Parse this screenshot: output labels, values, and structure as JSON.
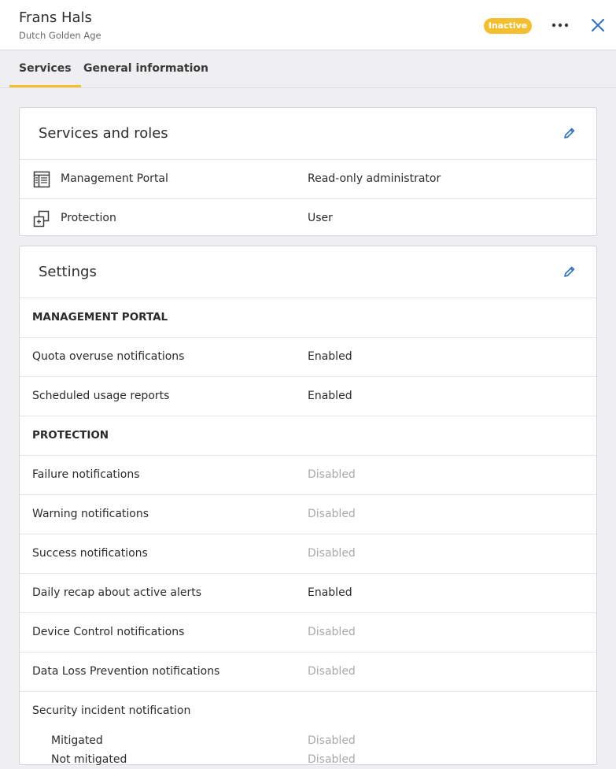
{
  "header": {
    "title": "Frans Hals",
    "subtitle": "Dutch Golden Age",
    "status_badge": "Inactive",
    "more_icon": "more-horizontal-icon",
    "close_icon": "close-icon"
  },
  "tabs": [
    {
      "label": "Services",
      "active": true
    },
    {
      "label": "General information",
      "active": false
    }
  ],
  "services_card": {
    "title": "Services and roles",
    "edit_icon": "pencil-icon",
    "rows": [
      {
        "icon": "management-portal-icon",
        "label": "Management Portal",
        "value": "Read-only administrator"
      },
      {
        "icon": "protection-icon",
        "label": "Protection",
        "value": "User"
      }
    ]
  },
  "settings_card": {
    "title": "Settings",
    "edit_icon": "pencil-icon",
    "sections": [
      {
        "heading": "MANAGEMENT PORTAL",
        "rows": [
          {
            "label": "Quota overuse notifications",
            "value": "Enabled"
          },
          {
            "label": "Scheduled usage reports",
            "value": "Enabled"
          }
        ]
      },
      {
        "heading": "PROTECTION",
        "rows": [
          {
            "label": "Failure notifications",
            "value": "Disabled"
          },
          {
            "label": "Warning notifications",
            "value": "Disabled"
          },
          {
            "label": "Success notifications",
            "value": "Disabled"
          },
          {
            "label": "Daily recap about active alerts",
            "value": "Enabled"
          },
          {
            "label": "Device Control notifications",
            "value": "Disabled"
          },
          {
            "label": "Data Loss Prevention notifications",
            "value": "Disabled"
          }
        ]
      }
    ],
    "security_incident": {
      "label": "Security incident notification",
      "subitems": [
        {
          "label": "Mitigated",
          "value": "Disabled"
        },
        {
          "label": "Not mitigated",
          "value": "Disabled"
        }
      ]
    }
  },
  "colors": {
    "accent": "#f3bf2e",
    "link_blue": "#2a6ebb",
    "background": "#efeff1",
    "disabled_text": "#a8a8ad"
  }
}
